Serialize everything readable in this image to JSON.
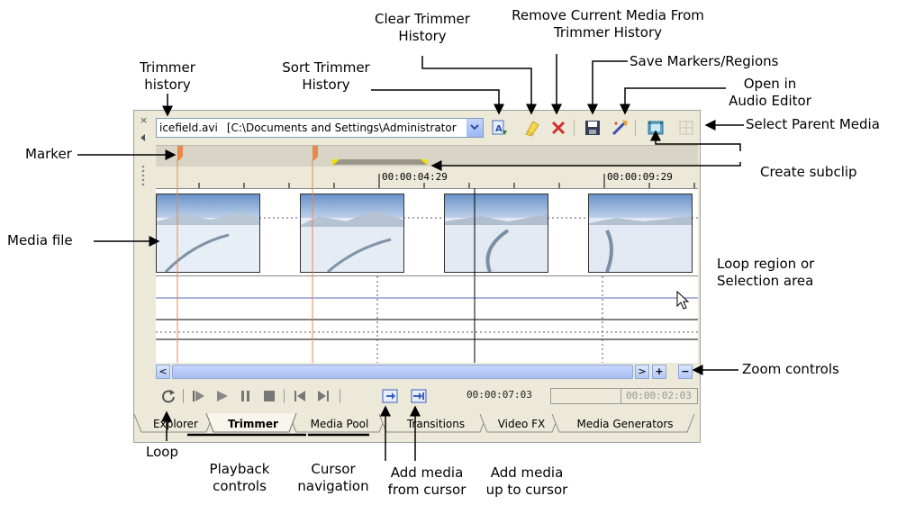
{
  "window": {
    "file_name": "icefield.avi",
    "file_path": "[C:\\Documents and Settings\\Administrator",
    "ruler_labels": [
      "00:00:04:29",
      "00:00:09:29"
    ],
    "timecodes": {
      "cursor": "00:00:07:03",
      "selection_start": "",
      "selection_length": "00:00:02:03"
    },
    "tabs": [
      {
        "label": "Explorer",
        "active": false
      },
      {
        "label": "Trimmer",
        "active": true
      },
      {
        "label": "Media Pool",
        "active": false
      },
      {
        "label": "Transitions",
        "active": false
      },
      {
        "label": "Video FX",
        "active": false
      },
      {
        "label": "Media Generators",
        "active": false
      }
    ]
  },
  "callouts": {
    "trimmer_history_1": "Trimmer",
    "trimmer_history_2": "history",
    "sort_history_1": "Sort Trimmer",
    "sort_history_2": "History",
    "clear_history_1": "Clear Trimmer",
    "clear_history_2": "History",
    "remove_media_1": "Remove Current Media From",
    "remove_media_2": "Trimmer History",
    "save_markers": "Save Markers/Regions",
    "open_audio_1": "Open in",
    "open_audio_2": "Audio Editor",
    "select_parent": "Select Parent Media",
    "marker": "Marker",
    "create_subclip": "Create subclip",
    "media_file": "Media file",
    "loop_region_1": "Loop region or",
    "loop_region_2": "Selection area",
    "zoom_controls": "Zoom controls",
    "loop": "Loop",
    "playback_1": "Playback",
    "playback_2": "controls",
    "cursor_nav_1": "Cursor",
    "cursor_nav_2": "navigation",
    "add_from_1": "Add media",
    "add_from_2": "from cursor",
    "add_upto_1": "Add media",
    "add_upto_2": "up to cursor"
  },
  "colors": {
    "accent_marker": "#e8894a",
    "selection_bar": "#9a9689",
    "loop_handle": "#f2e000"
  }
}
